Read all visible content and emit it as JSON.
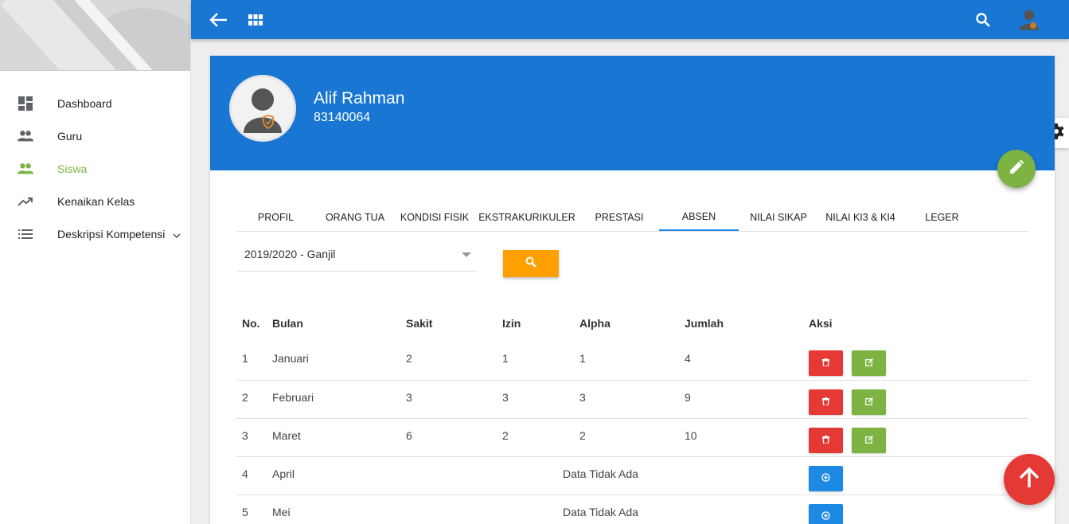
{
  "sidebar": {
    "items": [
      {
        "label": "Dashboard",
        "icon": "dashboard-icon",
        "active": false
      },
      {
        "label": "Guru",
        "icon": "people-icon",
        "active": false
      },
      {
        "label": "Siswa",
        "icon": "people-icon",
        "active": true
      },
      {
        "label": "Kenaikan Kelas",
        "icon": "trending-up-icon",
        "active": false
      },
      {
        "label": "Deskripsi Kompetensi",
        "icon": "list-icon",
        "active": false
      }
    ]
  },
  "topbar": {
    "back_icon": "arrow-left-icon",
    "apps_icon": "grid-icon",
    "search_icon": "search-icon",
    "user_icon": "user-avatar-icon"
  },
  "profile": {
    "name": "Alif Rahman",
    "nis": "83140064"
  },
  "tabs": [
    {
      "label": "PROFIL",
      "active": false
    },
    {
      "label": "ORANG TUA",
      "active": false
    },
    {
      "label": "KONDISI FISIK",
      "active": false
    },
    {
      "label": "EKSTRAKURIKULER",
      "active": false
    },
    {
      "label": "PRESTASI",
      "active": false
    },
    {
      "label": "ABSEN",
      "active": true
    },
    {
      "label": "NILAI SIKAP",
      "active": false
    },
    {
      "label": "NILAI KI3 & KI4",
      "active": false
    },
    {
      "label": "LEGER",
      "active": false
    }
  ],
  "filter": {
    "semester": "2019/2020 - Ganjil"
  },
  "table": {
    "headers": [
      "No.",
      "Bulan",
      "Sakit",
      "Izin",
      "Alpha",
      "Jumlah",
      "Aksi"
    ],
    "rows": [
      {
        "no": "1",
        "bulan": "Januari",
        "sakit": "2",
        "izin": "1",
        "alpha": "1",
        "jumlah": "4"
      },
      {
        "no": "2",
        "bulan": "Februari",
        "sakit": "3",
        "izin": "3",
        "alpha": "3",
        "jumlah": "9"
      },
      {
        "no": "3",
        "bulan": "Maret",
        "sakit": "6",
        "izin": "2",
        "alpha": "2",
        "jumlah": "10"
      },
      {
        "no": "4",
        "bulan": "April",
        "empty": "Data Tidak Ada"
      },
      {
        "no": "5",
        "bulan": "Mei",
        "empty": "Data Tidak Ada"
      }
    ]
  },
  "colors": {
    "primary": "#1976d2",
    "active": "#7cb342",
    "danger": "#e53935",
    "warning": "#ffa000",
    "info": "#1e88e5"
  }
}
